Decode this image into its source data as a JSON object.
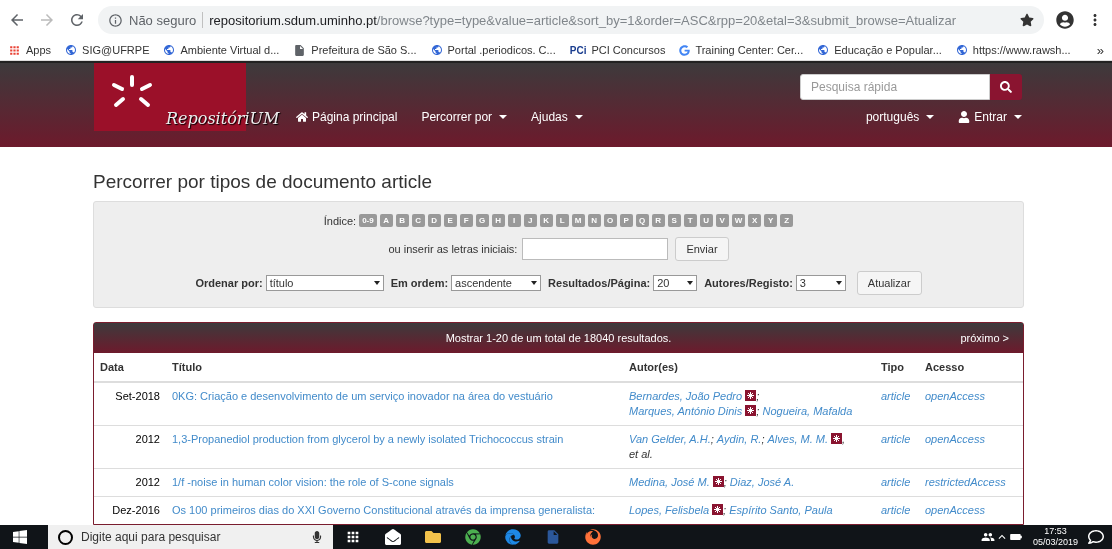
{
  "browser": {
    "security": "Não seguro",
    "url_host": "repositorium.sdum.uminho.pt",
    "url_path": "/browse?type=type&value=article&sort_by=1&order=ASC&rpp=20&etal=3&submit_browse=Atualizar",
    "bookmarks": [
      {
        "label": "Apps",
        "kind": "apps"
      },
      {
        "label": "SIG@UFRPE",
        "kind": "site"
      },
      {
        "label": "Ambiente Virtual d...",
        "kind": "site"
      },
      {
        "label": "Prefeitura de São S...",
        "kind": "page"
      },
      {
        "label": "Portal .periodicos. C...",
        "kind": "site"
      },
      {
        "label": "PCI Concursos",
        "kind": "text",
        "icon_text": "PCi"
      },
      {
        "label": "Training Center: Cer...",
        "kind": "google"
      },
      {
        "label": "Educação e Popular...",
        "kind": "site"
      },
      {
        "label": "https://www.rawsh...",
        "kind": "site"
      }
    ],
    "more": "»"
  },
  "header": {
    "logo": "RepositóriUM",
    "search_placeholder": "Pesquisa rápida",
    "nav": [
      {
        "label": "Página principal",
        "dropdown": false
      },
      {
        "label": "Percorrer por",
        "dropdown": true
      },
      {
        "label": "Ajudas",
        "dropdown": true
      }
    ],
    "right_nav": [
      {
        "label": "português",
        "dropdown": true
      },
      {
        "label": "Entrar",
        "dropdown": true
      }
    ]
  },
  "page_title": "Percorrer por tipos de documento article",
  "browse": {
    "index_label": "Índice:",
    "letters": [
      "0-9",
      "A",
      "B",
      "C",
      "D",
      "E",
      "F",
      "G",
      "H",
      "I",
      "J",
      "K",
      "L",
      "M",
      "N",
      "O",
      "P",
      "Q",
      "R",
      "S",
      "T",
      "U",
      "V",
      "W",
      "X",
      "Y",
      "Z"
    ],
    "starts_with_label": "ou inserir as letras iniciais:",
    "send": "Enviar",
    "selects": [
      {
        "label": "Ordenar por:",
        "value": "título"
      },
      {
        "label": "Em ordem:",
        "value": "ascendente"
      },
      {
        "label": "Resultados/Página:",
        "value": "20"
      },
      {
        "label": "Autores/Registo:",
        "value": "3"
      }
    ],
    "update": "Atualizar"
  },
  "results": {
    "summary": "Mostrar 1-20 de um total de 18040 resultados.",
    "next": "próximo >",
    "columns": [
      "Data",
      "Título",
      "Autor(es)",
      "Tipo",
      "Acesso"
    ],
    "rows": [
      {
        "date": "Set-2018",
        "title": "0KG: Criação e desenvolvimento de um serviço inovador na área do vestuário",
        "authors": [
          {
            "name": "Bernardes, João Pedro",
            "verified": true,
            "after": ";"
          },
          {
            "name": "Marques, António Dinis",
            "verified": true,
            "after": ";"
          },
          {
            "name": "Nogueira, Mafalda",
            "verified": false
          }
        ],
        "type": "article",
        "access": "openAccess"
      },
      {
        "date": "2012",
        "title": "1,3-Propanediol production from glycerol by a newly isolated Trichococcus strain",
        "authors": [
          {
            "name": "Van Gelder, A.H.",
            "verified": false,
            "after": ";"
          },
          {
            "name": "Aydin, R.",
            "verified": false,
            "after": ";"
          },
          {
            "name": "Alves, M. M.",
            "verified": true,
            "after": ","
          }
        ],
        "extra": "et al.",
        "type": "article",
        "access": "openAccess"
      },
      {
        "date": "2012",
        "title": "1/f -noise in human color vision: the role of S-cone signals",
        "authors": [
          {
            "name": "Medina, José M.",
            "verified": true,
            "after": ";"
          },
          {
            "name": "Diaz, José A.",
            "verified": false
          }
        ],
        "type": "article",
        "access": "restrictedAccess"
      },
      {
        "date": "Dez-2016",
        "title": "Os 100 primeiros dias do XXI Governo Constitucional através da imprensa generalista:",
        "authors": [
          {
            "name": "Lopes, Felisbela",
            "verified": true,
            "after": ";"
          },
          {
            "name": "Espírito Santo, Paula",
            "verified": false
          }
        ],
        "type": "article",
        "access": "openAccess"
      }
    ]
  },
  "taskbar": {
    "search_placeholder": "Digite aqui para pesquisar",
    "time": "17:53",
    "date": "05/03/2019"
  }
}
